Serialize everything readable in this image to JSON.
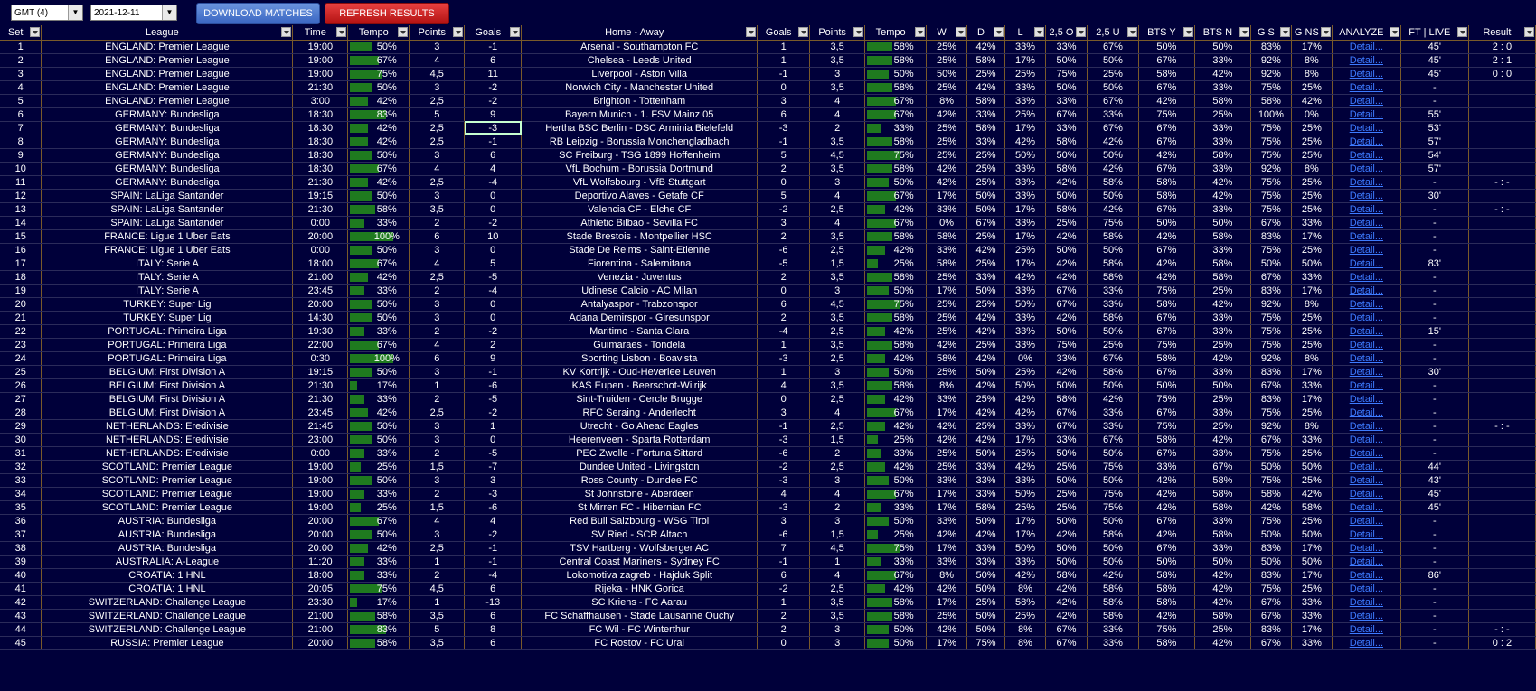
{
  "toolbar": {
    "timezone": "GMT (4)",
    "date": "2021-12-11",
    "download_label": "DOWNLOAD MATCHES",
    "refresh_label": "REFRESH RESULTS"
  },
  "columns": [
    "Set",
    "League",
    "Time",
    "Tempo",
    "Points",
    "Goals",
    "Home - Away",
    "Goals",
    "Points",
    "Tempo",
    "W",
    "D",
    "L",
    "2,5 O",
    "2,5 U",
    "BTS Y",
    "BTS N",
    "G S",
    "G NS",
    "ANALYZE",
    "FT | LIVE",
    "Result"
  ],
  "analyze_link": "Detail...",
  "rows": [
    [
      "1",
      "ENGLAND: Premier League",
      "19:00",
      "50%",
      "3",
      "-1",
      "Arsenal - Southampton FC",
      "1",
      "3,5",
      "58%",
      "25%",
      "42%",
      "33%",
      "33%",
      "67%",
      "50%",
      "50%",
      "83%",
      "17%",
      "45'",
      "2 : 0"
    ],
    [
      "2",
      "ENGLAND: Premier League",
      "19:00",
      "67%",
      "4",
      "6",
      "Chelsea - Leeds United",
      "1",
      "3,5",
      "58%",
      "25%",
      "58%",
      "17%",
      "50%",
      "50%",
      "67%",
      "33%",
      "92%",
      "8%",
      "45'",
      "2 : 1"
    ],
    [
      "3",
      "ENGLAND: Premier League",
      "19:00",
      "75%",
      "4,5",
      "11",
      "Liverpool - Aston Villa",
      "-1",
      "3",
      "50%",
      "50%",
      "25%",
      "25%",
      "75%",
      "25%",
      "58%",
      "42%",
      "92%",
      "8%",
      "45'",
      "0 : 0"
    ],
    [
      "4",
      "ENGLAND: Premier League",
      "21:30",
      "50%",
      "3",
      "-2",
      "Norwich City - Manchester United",
      "0",
      "3,5",
      "58%",
      "25%",
      "42%",
      "33%",
      "50%",
      "50%",
      "67%",
      "33%",
      "75%",
      "25%",
      "-",
      ""
    ],
    [
      "5",
      "ENGLAND: Premier League",
      "3:00",
      "42%",
      "2,5",
      "-2",
      "Brighton - Tottenham",
      "3",
      "4",
      "67%",
      "8%",
      "58%",
      "33%",
      "33%",
      "67%",
      "42%",
      "58%",
      "58%",
      "42%",
      "-",
      ""
    ],
    [
      "6",
      "GERMANY: Bundesliga",
      "18:30",
      "83%",
      "5",
      "9",
      "Bayern Munich - 1. FSV Mainz 05",
      "6",
      "4",
      "67%",
      "42%",
      "33%",
      "25%",
      "67%",
      "33%",
      "75%",
      "25%",
      "100%",
      "0%",
      "55'",
      ""
    ],
    [
      "7",
      "GERMANY: Bundesliga",
      "18:30",
      "42%",
      "2,5",
      "-3",
      "Hertha BSC Berlin - DSC Arminia Bielefeld",
      "-3",
      "2",
      "33%",
      "25%",
      "58%",
      "17%",
      "33%",
      "67%",
      "67%",
      "33%",
      "75%",
      "25%",
      "53'",
      ""
    ],
    [
      "8",
      "GERMANY: Bundesliga",
      "18:30",
      "42%",
      "2,5",
      "-1",
      "RB Leipzig - Borussia Monchengladbach",
      "-1",
      "3,5",
      "58%",
      "25%",
      "33%",
      "42%",
      "58%",
      "42%",
      "67%",
      "33%",
      "75%",
      "25%",
      "57'",
      ""
    ],
    [
      "9",
      "GERMANY: Bundesliga",
      "18:30",
      "50%",
      "3",
      "6",
      "SC Freiburg - TSG 1899 Hoffenheim",
      "5",
      "4,5",
      "75%",
      "25%",
      "25%",
      "50%",
      "50%",
      "50%",
      "42%",
      "58%",
      "75%",
      "25%",
      "54'",
      ""
    ],
    [
      "10",
      "GERMANY: Bundesliga",
      "18:30",
      "67%",
      "4",
      "4",
      "VfL Bochum - Borussia Dortmund",
      "2",
      "3,5",
      "58%",
      "42%",
      "25%",
      "33%",
      "58%",
      "42%",
      "67%",
      "33%",
      "92%",
      "8%",
      "57'",
      ""
    ],
    [
      "11",
      "GERMANY: Bundesliga",
      "21:30",
      "42%",
      "2,5",
      "-4",
      "VfL Wolfsbourg - VfB Stuttgart",
      "0",
      "3",
      "50%",
      "42%",
      "25%",
      "33%",
      "42%",
      "58%",
      "58%",
      "42%",
      "75%",
      "25%",
      "-",
      "- : -"
    ],
    [
      "12",
      "SPAIN: LaLiga Santander",
      "19:15",
      "50%",
      "3",
      "0",
      "Deportivo Alaves - Getafe CF",
      "5",
      "4",
      "67%",
      "17%",
      "50%",
      "33%",
      "50%",
      "50%",
      "58%",
      "42%",
      "75%",
      "25%",
      "30'",
      ""
    ],
    [
      "13",
      "SPAIN: LaLiga Santander",
      "21:30",
      "58%",
      "3,5",
      "0",
      "Valencia CF - Elche CF",
      "-2",
      "2,5",
      "42%",
      "33%",
      "50%",
      "17%",
      "58%",
      "42%",
      "67%",
      "33%",
      "75%",
      "25%",
      "-",
      "- : -"
    ],
    [
      "14",
      "SPAIN: LaLiga Santander",
      "0:00",
      "33%",
      "2",
      "-2",
      "Athletic Bilbao - Sevilla FC",
      "3",
      "4",
      "67%",
      "0%",
      "67%",
      "33%",
      "25%",
      "75%",
      "50%",
      "50%",
      "67%",
      "33%",
      "-",
      ""
    ],
    [
      "15",
      "FRANCE: Ligue 1 Uber Eats",
      "20:00",
      "100%",
      "6",
      "10",
      "Stade Brestois - Montpellier HSC",
      "2",
      "3,5",
      "58%",
      "58%",
      "25%",
      "17%",
      "42%",
      "58%",
      "42%",
      "58%",
      "83%",
      "17%",
      "-",
      ""
    ],
    [
      "16",
      "FRANCE: Ligue 1 Uber Eats",
      "0:00",
      "50%",
      "3",
      "0",
      "Stade De Reims - Saint-Etienne",
      "-6",
      "2,5",
      "42%",
      "33%",
      "42%",
      "25%",
      "50%",
      "50%",
      "67%",
      "33%",
      "75%",
      "25%",
      "-",
      ""
    ],
    [
      "17",
      "ITALY: Serie A",
      "18:00",
      "67%",
      "4",
      "5",
      "Fiorentina - Salernitana",
      "-5",
      "1,5",
      "25%",
      "58%",
      "25%",
      "17%",
      "42%",
      "58%",
      "42%",
      "58%",
      "50%",
      "50%",
      "83'",
      ""
    ],
    [
      "18",
      "ITALY: Serie A",
      "21:00",
      "42%",
      "2,5",
      "-5",
      "Venezia - Juventus",
      "2",
      "3,5",
      "58%",
      "25%",
      "33%",
      "42%",
      "42%",
      "58%",
      "42%",
      "58%",
      "67%",
      "33%",
      "-",
      ""
    ],
    [
      "19",
      "ITALY: Serie A",
      "23:45",
      "33%",
      "2",
      "-4",
      "Udinese Calcio - AC Milan",
      "0",
      "3",
      "50%",
      "17%",
      "50%",
      "33%",
      "67%",
      "33%",
      "75%",
      "25%",
      "83%",
      "17%",
      "-",
      ""
    ],
    [
      "20",
      "TURKEY: Super Lig",
      "20:00",
      "50%",
      "3",
      "0",
      "Antalyaspor - Trabzonspor",
      "6",
      "4,5",
      "75%",
      "25%",
      "25%",
      "50%",
      "67%",
      "33%",
      "58%",
      "42%",
      "92%",
      "8%",
      "-",
      ""
    ],
    [
      "21",
      "TURKEY: Super Lig",
      "14:30",
      "50%",
      "3",
      "0",
      "Adana Demirspor - Giresunspor",
      "2",
      "3,5",
      "58%",
      "25%",
      "42%",
      "33%",
      "42%",
      "58%",
      "67%",
      "33%",
      "75%",
      "25%",
      "-",
      ""
    ],
    [
      "22",
      "PORTUGAL: Primeira Liga",
      "19:30",
      "33%",
      "2",
      "-2",
      "Maritimo - Santa Clara",
      "-4",
      "2,5",
      "42%",
      "25%",
      "42%",
      "33%",
      "50%",
      "50%",
      "67%",
      "33%",
      "75%",
      "25%",
      "15'",
      ""
    ],
    [
      "23",
      "PORTUGAL: Primeira Liga",
      "22:00",
      "67%",
      "4",
      "2",
      "Guimaraes - Tondela",
      "1",
      "3,5",
      "58%",
      "42%",
      "25%",
      "33%",
      "75%",
      "25%",
      "75%",
      "25%",
      "75%",
      "25%",
      "-",
      ""
    ],
    [
      "24",
      "PORTUGAL: Primeira Liga",
      "0:30",
      "100%",
      "6",
      "9",
      "Sporting Lisbon - Boavista",
      "-3",
      "2,5",
      "42%",
      "58%",
      "42%",
      "0%",
      "33%",
      "67%",
      "58%",
      "42%",
      "92%",
      "8%",
      "-",
      ""
    ],
    [
      "25",
      "BELGIUM: First Division A",
      "19:15",
      "50%",
      "3",
      "-1",
      "KV Kortrijk - Oud-Heverlee Leuven",
      "1",
      "3",
      "50%",
      "25%",
      "50%",
      "25%",
      "42%",
      "58%",
      "67%",
      "33%",
      "83%",
      "17%",
      "30'",
      ""
    ],
    [
      "26",
      "BELGIUM: First Division A",
      "21:30",
      "17%",
      "1",
      "-6",
      "KAS Eupen - Beerschot-Wilrijk",
      "4",
      "3,5",
      "58%",
      "8%",
      "42%",
      "50%",
      "50%",
      "50%",
      "50%",
      "50%",
      "67%",
      "33%",
      "-",
      ""
    ],
    [
      "27",
      "BELGIUM: First Division A",
      "21:30",
      "33%",
      "2",
      "-5",
      "Sint-Truiden - Cercle Brugge",
      "0",
      "2,5",
      "42%",
      "33%",
      "25%",
      "42%",
      "58%",
      "42%",
      "75%",
      "25%",
      "83%",
      "17%",
      "-",
      ""
    ],
    [
      "28",
      "BELGIUM: First Division A",
      "23:45",
      "42%",
      "2,5",
      "-2",
      "RFC Seraing - Anderlecht",
      "3",
      "4",
      "67%",
      "17%",
      "42%",
      "42%",
      "67%",
      "33%",
      "67%",
      "33%",
      "75%",
      "25%",
      "-",
      ""
    ],
    [
      "29",
      "NETHERLANDS: Eredivisie",
      "21:45",
      "50%",
      "3",
      "1",
      "Utrecht - Go Ahead Eagles",
      "-1",
      "2,5",
      "42%",
      "42%",
      "25%",
      "33%",
      "67%",
      "33%",
      "75%",
      "25%",
      "92%",
      "8%",
      "-",
      "- : -"
    ],
    [
      "30",
      "NETHERLANDS: Eredivisie",
      "23:00",
      "50%",
      "3",
      "0",
      "Heerenveen - Sparta Rotterdam",
      "-3",
      "1,5",
      "25%",
      "42%",
      "42%",
      "17%",
      "33%",
      "67%",
      "58%",
      "42%",
      "67%",
      "33%",
      "-",
      ""
    ],
    [
      "31",
      "NETHERLANDS: Eredivisie",
      "0:00",
      "33%",
      "2",
      "-5",
      "PEC Zwolle - Fortuna Sittard",
      "-6",
      "2",
      "33%",
      "25%",
      "50%",
      "25%",
      "50%",
      "50%",
      "67%",
      "33%",
      "75%",
      "25%",
      "-",
      ""
    ],
    [
      "32",
      "SCOTLAND: Premier League",
      "19:00",
      "25%",
      "1,5",
      "-7",
      "Dundee United - Livingston",
      "-2",
      "2,5",
      "42%",
      "25%",
      "33%",
      "42%",
      "25%",
      "75%",
      "33%",
      "67%",
      "50%",
      "50%",
      "44'",
      ""
    ],
    [
      "33",
      "SCOTLAND: Premier League",
      "19:00",
      "50%",
      "3",
      "3",
      "Ross County - Dundee FC",
      "-3",
      "3",
      "50%",
      "33%",
      "33%",
      "33%",
      "50%",
      "50%",
      "42%",
      "58%",
      "75%",
      "25%",
      "43'",
      ""
    ],
    [
      "34",
      "SCOTLAND: Premier League",
      "19:00",
      "33%",
      "2",
      "-3",
      "St Johnstone - Aberdeen",
      "4",
      "4",
      "67%",
      "17%",
      "33%",
      "50%",
      "25%",
      "75%",
      "42%",
      "58%",
      "58%",
      "42%",
      "45'",
      ""
    ],
    [
      "35",
      "SCOTLAND: Premier League",
      "19:00",
      "25%",
      "1,5",
      "-6",
      "St Mirren FC - Hibernian FC",
      "-3",
      "2",
      "33%",
      "17%",
      "58%",
      "25%",
      "25%",
      "75%",
      "42%",
      "58%",
      "42%",
      "58%",
      "45'",
      ""
    ],
    [
      "36",
      "AUSTRIA: Bundesliga",
      "20:00",
      "67%",
      "4",
      "4",
      "Red Bull Salzbourg - WSG Tirol",
      "3",
      "3",
      "50%",
      "33%",
      "50%",
      "17%",
      "50%",
      "50%",
      "67%",
      "33%",
      "75%",
      "25%",
      "-",
      ""
    ],
    [
      "37",
      "AUSTRIA: Bundesliga",
      "20:00",
      "50%",
      "3",
      "-2",
      "SV Ried - SCR Altach",
      "-6",
      "1,5",
      "25%",
      "42%",
      "42%",
      "17%",
      "42%",
      "58%",
      "42%",
      "58%",
      "50%",
      "50%",
      "-",
      ""
    ],
    [
      "38",
      "AUSTRIA: Bundesliga",
      "20:00",
      "42%",
      "2,5",
      "-1",
      "TSV Hartberg - Wolfsberger AC",
      "7",
      "4,5",
      "75%",
      "17%",
      "33%",
      "50%",
      "50%",
      "50%",
      "67%",
      "33%",
      "83%",
      "17%",
      "-",
      ""
    ],
    [
      "39",
      "AUSTRALIA: A-League",
      "11:20",
      "33%",
      "1",
      "-1",
      "Central Coast Mariners - Sydney FC",
      "-1",
      "1",
      "33%",
      "33%",
      "33%",
      "33%",
      "50%",
      "50%",
      "50%",
      "50%",
      "50%",
      "50%",
      "-",
      ""
    ],
    [
      "40",
      "CROATIA: 1 HNL",
      "18:00",
      "33%",
      "2",
      "-4",
      "Lokomotiva zagreb - Hajduk Split",
      "6",
      "4",
      "67%",
      "8%",
      "50%",
      "42%",
      "58%",
      "42%",
      "58%",
      "42%",
      "83%",
      "17%",
      "86'",
      ""
    ],
    [
      "41",
      "CROATIA: 1 HNL",
      "20:05",
      "75%",
      "4,5",
      "6",
      "Rijeka - HNK Gorica",
      "-2",
      "2,5",
      "42%",
      "42%",
      "50%",
      "8%",
      "42%",
      "58%",
      "58%",
      "42%",
      "75%",
      "25%",
      "-",
      ""
    ],
    [
      "42",
      "SWITZERLAND: Challenge League",
      "23:30",
      "17%",
      "1",
      "-13",
      "SC Kriens - FC Aarau",
      "1",
      "3,5",
      "58%",
      "17%",
      "25%",
      "58%",
      "42%",
      "58%",
      "58%",
      "42%",
      "67%",
      "33%",
      "-",
      ""
    ],
    [
      "43",
      "SWITZERLAND: Challenge League",
      "21:00",
      "58%",
      "3,5",
      "6",
      "FC Schaffhausen - Stade Lausanne Ouchy",
      "2",
      "3,5",
      "58%",
      "25%",
      "50%",
      "25%",
      "42%",
      "58%",
      "42%",
      "58%",
      "67%",
      "33%",
      "-",
      ""
    ],
    [
      "44",
      "SWITZERLAND: Challenge League",
      "21:00",
      "83%",
      "5",
      "8",
      "FC Wil - FC Winterthur",
      "2",
      "3",
      "50%",
      "42%",
      "50%",
      "8%",
      "67%",
      "33%",
      "75%",
      "25%",
      "83%",
      "17%",
      "-",
      "- : -"
    ],
    [
      "45",
      "RUSSIA: Premier League",
      "20:00",
      "58%",
      "3,5",
      "6",
      "FC Rostov - FC Ural",
      "0",
      "3",
      "50%",
      "17%",
      "75%",
      "8%",
      "67%",
      "33%",
      "58%",
      "42%",
      "67%",
      "33%",
      "-",
      "0 : 2"
    ]
  ]
}
